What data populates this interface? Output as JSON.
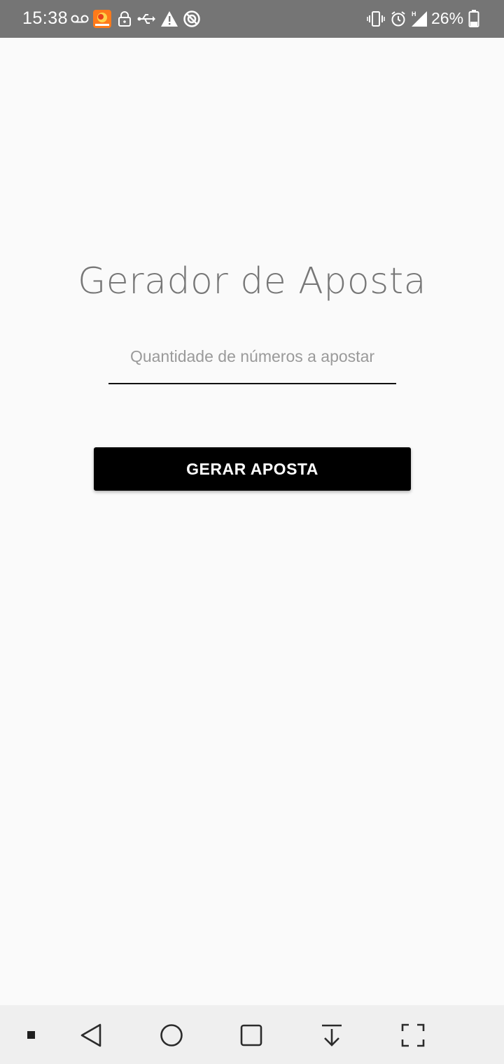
{
  "status_bar": {
    "time": "15:38",
    "battery_percent": "26%",
    "icons_left": [
      "voicemail-icon",
      "app-notification-icon",
      "lock-icon",
      "usb-icon",
      "warning-icon",
      "data-saver-icon"
    ],
    "icons_right": [
      "vibrate-icon",
      "alarm-icon",
      "signal-icon",
      "battery-icon"
    ],
    "color": "#757575"
  },
  "main": {
    "title": "Gerador de Aposta",
    "input": {
      "placeholder": "Quantidade de números a apostar",
      "value": ""
    },
    "button_label": "GERAR APOSTA"
  },
  "nav_bar": {
    "items": [
      "menu-dot-icon",
      "back-icon",
      "home-icon",
      "recents-icon",
      "pull-down-icon",
      "fullscreen-icon"
    ]
  },
  "colors": {
    "background": "#fafafa",
    "accent": "#000000",
    "title_text": "#777777"
  }
}
